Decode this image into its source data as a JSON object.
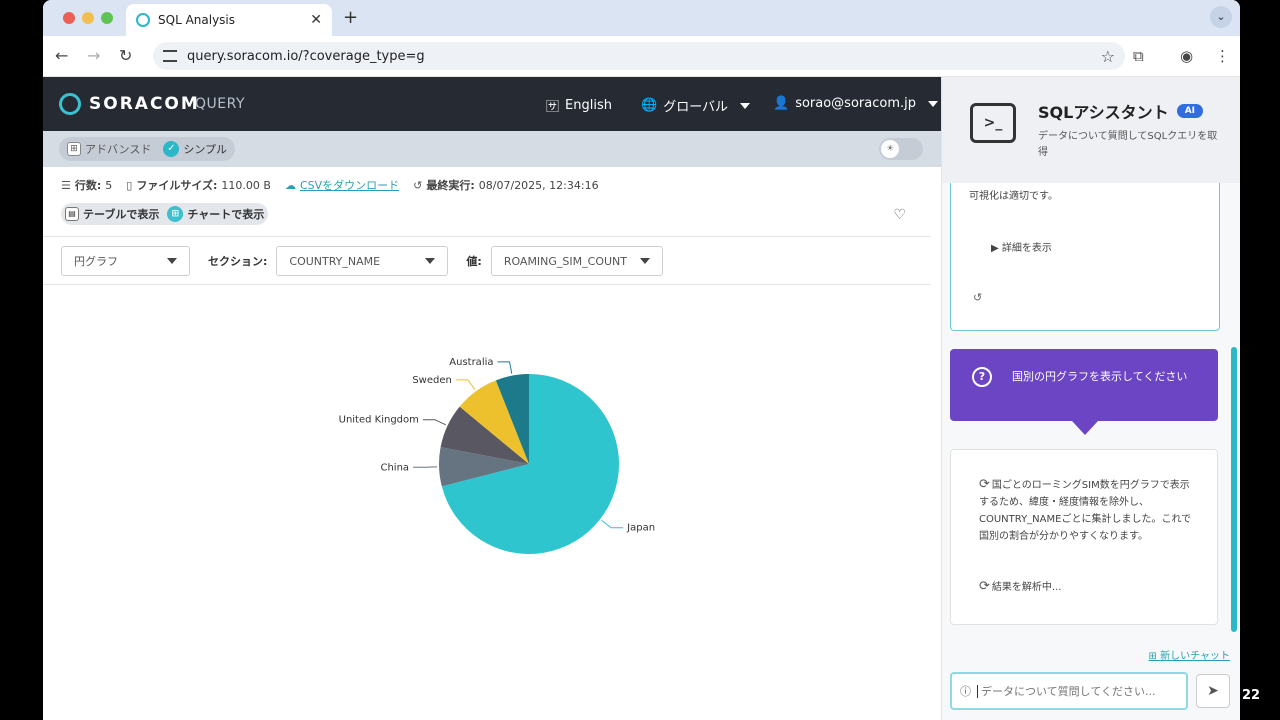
{
  "browser": {
    "tab_title": "SQL Analysis",
    "url": "query.soracom.io/?coverage_type=g",
    "colors": {
      "close": "#ec5f55",
      "minimize": "#f3bd4f",
      "maximize": "#5fc454"
    }
  },
  "header": {
    "logo": "SORACOM",
    "product": "QUERY",
    "language": "English",
    "region": "グローバル",
    "user": "sorao@soracom.jp"
  },
  "mode": {
    "advanced": "アドバンスド",
    "simple": "シンプル"
  },
  "meta": {
    "rows_label": "行数:",
    "rows_value": "5",
    "filesize_label": "ファイルサイズ:",
    "filesize_value": "110.00 B",
    "csv_link": "CSVをダウンロード",
    "last_run_label": "最終実行:",
    "last_run_value": "08/07/2025, 12:34:16"
  },
  "view": {
    "table": "テーブルで表示",
    "chart": "チャートで表示"
  },
  "controls": {
    "chart_type": "円グラフ",
    "section_label": "セクション:",
    "section_value": "COUNTRY_NAME",
    "value_label": "値:",
    "value_value": "ROAMING_SIM_COUNT"
  },
  "chart_data": {
    "type": "pie",
    "categories": [
      "Japan",
      "China",
      "United Kingdom",
      "Sweden",
      "Australia"
    ],
    "values": [
      71,
      7,
      8,
      8,
      6
    ],
    "colors": [
      "#2ec5cf",
      "#667380",
      "#595761",
      "#ecc12d",
      "#1c7a8a"
    ]
  },
  "assistant": {
    "title": "SQLアシスタント",
    "badge": "AI",
    "description": "データについて質問してSQLクエリを取得",
    "prev_text": "可視化は適切です。",
    "details": "詳細を表示",
    "user_message": "国別の円グラフを表示してください",
    "reply": "国ごとのローミングSIM数を円グラフで表示するため、緯度・経度情報を除外し、COUNTRY_NAMEごとに集計しました。これで国別の割合が分かりやすくなります。",
    "analyzing": "結果を解析中...",
    "new_chat": "新しいチャット",
    "input_placeholder": "データについて質問してください..."
  },
  "page_number": "22"
}
